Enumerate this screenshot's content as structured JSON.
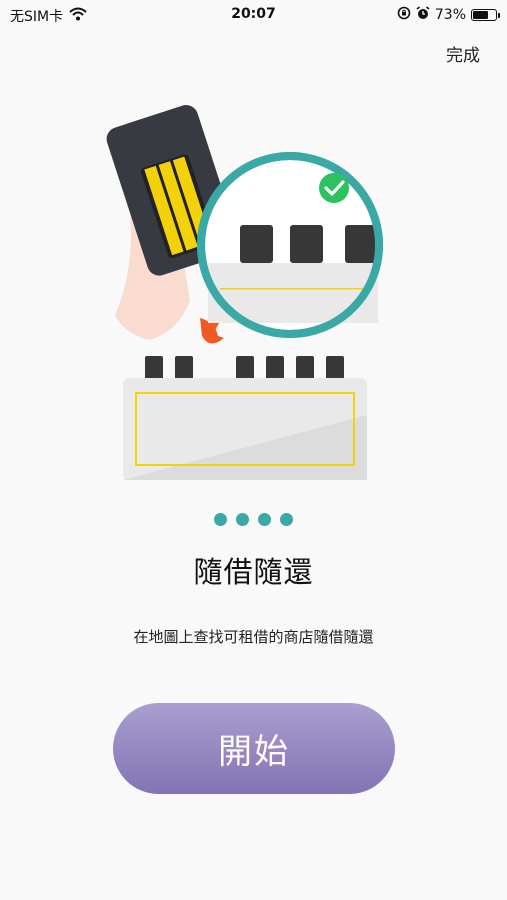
{
  "status_bar": {
    "carrier": "无SIM卡",
    "time": "20:07",
    "battery_percent": "73%",
    "battery_level": 0.73,
    "icons": [
      "wifi-icon",
      "orientation-lock-icon",
      "alarm-icon",
      "battery-icon"
    ]
  },
  "header": {
    "done_label": "完成"
  },
  "illustration": {
    "icons": [
      "power-bank-icon",
      "check-icon",
      "charging-station-icon",
      "arrow-down-icon"
    ]
  },
  "pager": {
    "total": 4
  },
  "content": {
    "title": "隨借隨還",
    "subtitle": "在地圖上查找可租借的商店隨借隨還"
  },
  "actions": {
    "start_label": "開始"
  },
  "colors": {
    "accent": "#3aa9a5",
    "button_top": "#a99fd0",
    "button_bottom": "#8374b3",
    "yellow": "#f4d20b",
    "arrow": "#f05a22"
  }
}
